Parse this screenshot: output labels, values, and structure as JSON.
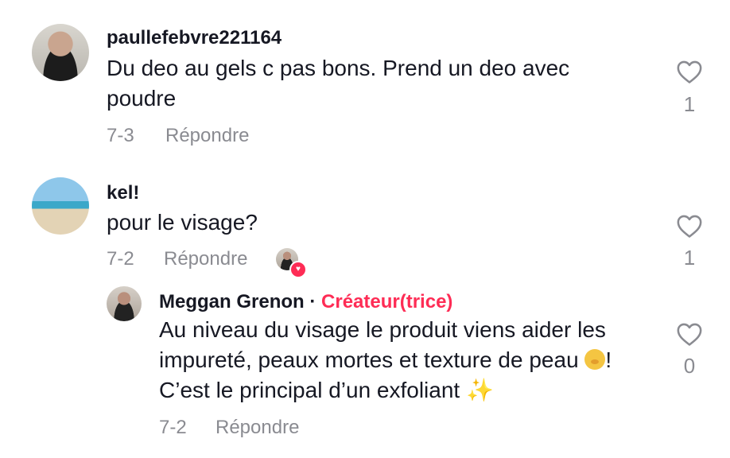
{
  "comments": [
    {
      "username": "paullefebvre221164",
      "text_line1": "Du deo au gels c pas bons. Prend un deo avec",
      "text_line2": "poudre",
      "date": "7-3",
      "reply_label": "Répondre",
      "likes": "1"
    },
    {
      "username": "kel!",
      "text_line1": "pour le visage?",
      "date": "7-2",
      "reply_label": "Répondre",
      "likes": "1"
    }
  ],
  "reply": {
    "username": "Meggan Grenon",
    "separator": "·",
    "badge": "Créateur(trice)",
    "text_line1": "Au niveau du visage le produit viens aider les",
    "text_line2": "impureté, peaux mortes et texture de peau",
    "text_line2_end": "!",
    "text_line3": "C’est le principal d’un exfoliant",
    "sparkle": "✨",
    "date": "7-2",
    "reply_label": "Répondre",
    "likes": "0"
  },
  "heart_badge": "♥",
  "colors": {
    "accent": "#fe2c55",
    "muted": "#8a8b91",
    "text": "#161823"
  }
}
